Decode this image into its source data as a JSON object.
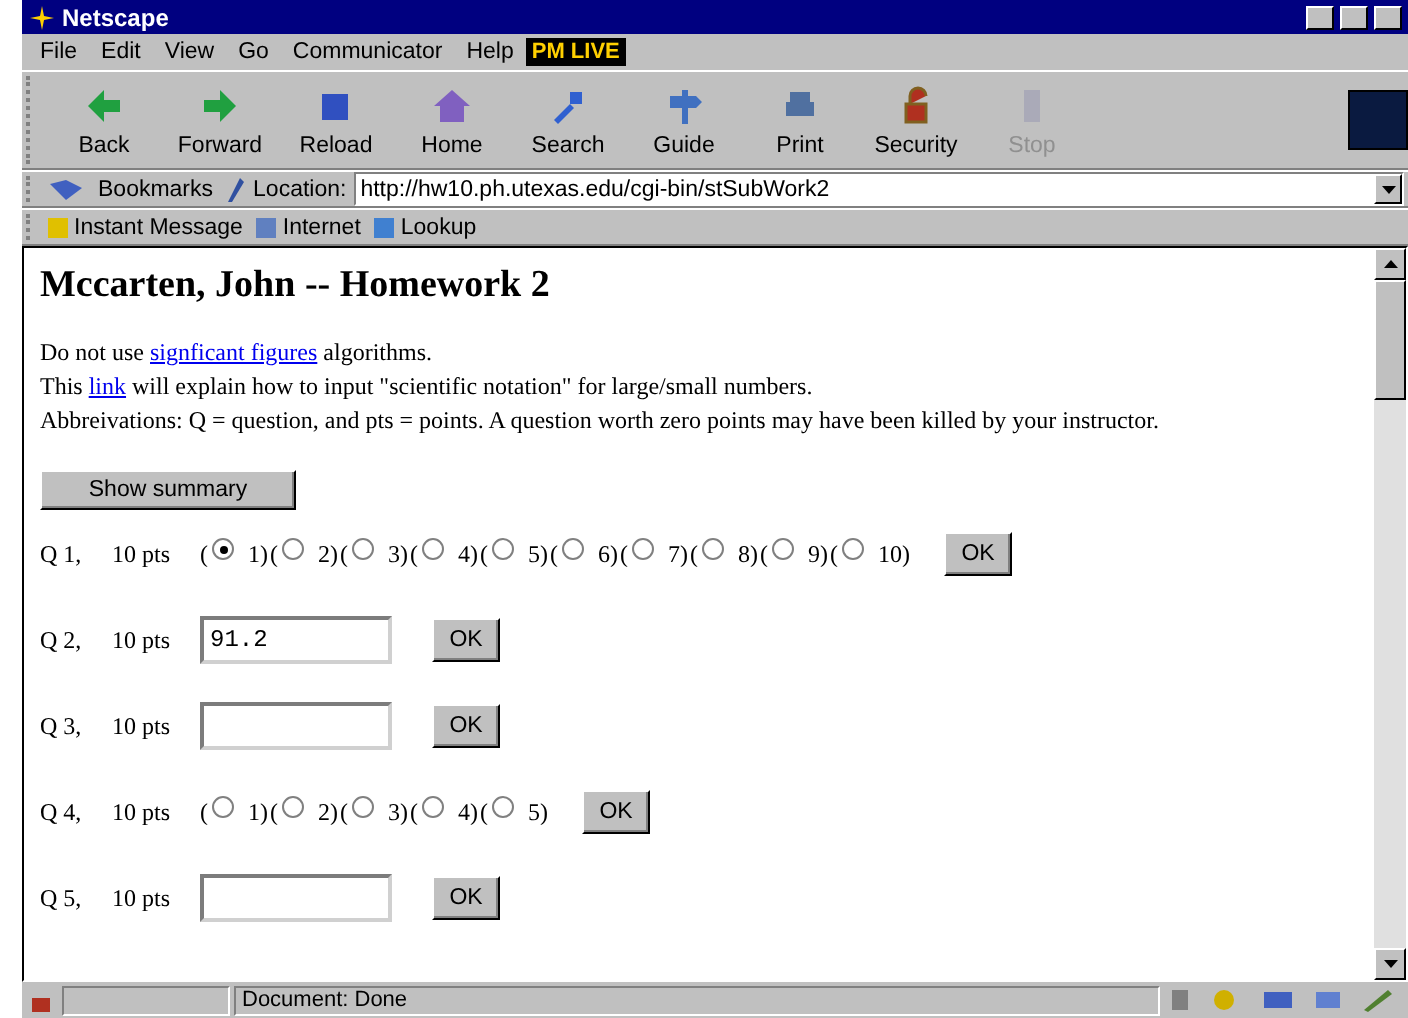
{
  "window": {
    "title": "Netscape"
  },
  "menu": [
    "File",
    "Edit",
    "View",
    "Go",
    "Communicator",
    "Help"
  ],
  "menu_badge": "PM LIVE",
  "toolbar": [
    {
      "label": "Back",
      "disabled": false
    },
    {
      "label": "Forward",
      "disabled": false
    },
    {
      "label": "Reload",
      "disabled": false
    },
    {
      "label": "Home",
      "disabled": false
    },
    {
      "label": "Search",
      "disabled": false
    },
    {
      "label": "Guide",
      "disabled": false
    },
    {
      "label": "Print",
      "disabled": false
    },
    {
      "label": "Security",
      "disabled": false
    },
    {
      "label": "Stop",
      "disabled": true
    }
  ],
  "location_bar": {
    "bookmarks": "Bookmarks",
    "label": "Location:",
    "url": "http://hw10.ph.utexas.edu/cgi-bin/stSubWork2"
  },
  "personal_bar": [
    "Instant Message",
    "Internet",
    "Lookup"
  ],
  "page": {
    "heading": "Mccarten, John -- Homework 2",
    "lines": [
      {
        "before": "Do not use ",
        "link": "signficant figures",
        "after": " algorithms."
      },
      {
        "before": "This ",
        "link": "link",
        "after": " will explain how to input \"scientific notation\" for large/small numbers."
      },
      {
        "before": "Abbreivations: Q = question, and pts = points. A question worth zero points may have been killed by your instructor."
      }
    ],
    "summary_button": "Show summary",
    "questions": [
      {
        "kind": "choice",
        "label": "Q 1,",
        "points": "10 pts",
        "options": [
          {
            "prefix": "(",
            "label": "1)",
            "selected": true
          },
          {
            "prefix": "(",
            "label": "2)",
            "selected": false
          },
          {
            "prefix": "(",
            "label": "3)",
            "selected": false
          },
          {
            "prefix": "(",
            "label": "4)",
            "selected": false
          },
          {
            "prefix": "(",
            "label": "5)",
            "selected": false
          },
          {
            "prefix": "(",
            "label": "6)",
            "selected": false
          },
          {
            "prefix": "(",
            "label": "7)",
            "selected": false
          },
          {
            "prefix": "(",
            "label": "8)",
            "selected": false
          },
          {
            "prefix": "(",
            "label": "9)",
            "selected": false
          },
          {
            "prefix": "(",
            "label": "10)",
            "selected": false
          }
        ],
        "button": "OK"
      },
      {
        "kind": "text",
        "label": "Q 2,",
        "points": "10 pts",
        "value": "91.2",
        "button": "OK"
      },
      {
        "kind": "text",
        "label": "Q 3,",
        "points": "10 pts",
        "button": "OK"
      },
      {
        "kind": "choice",
        "label": "Q 4,",
        "points": "10 pts",
        "options": [
          {
            "prefix": "(",
            "label": "1)",
            "selected": false
          },
          {
            "prefix": "(",
            "label": "2)",
            "selected": false
          },
          {
            "prefix": "(",
            "label": "3)",
            "selected": false
          },
          {
            "prefix": "(",
            "label": "4)",
            "selected": false
          },
          {
            "prefix": "(",
            "label": "5)",
            "selected": false
          }
        ],
        "button": "OK"
      },
      {
        "kind": "text",
        "label": "Q 5,",
        "points": "10 pts",
        "button": "OK"
      }
    ]
  },
  "status_bar": {
    "text": "Document: Done"
  }
}
